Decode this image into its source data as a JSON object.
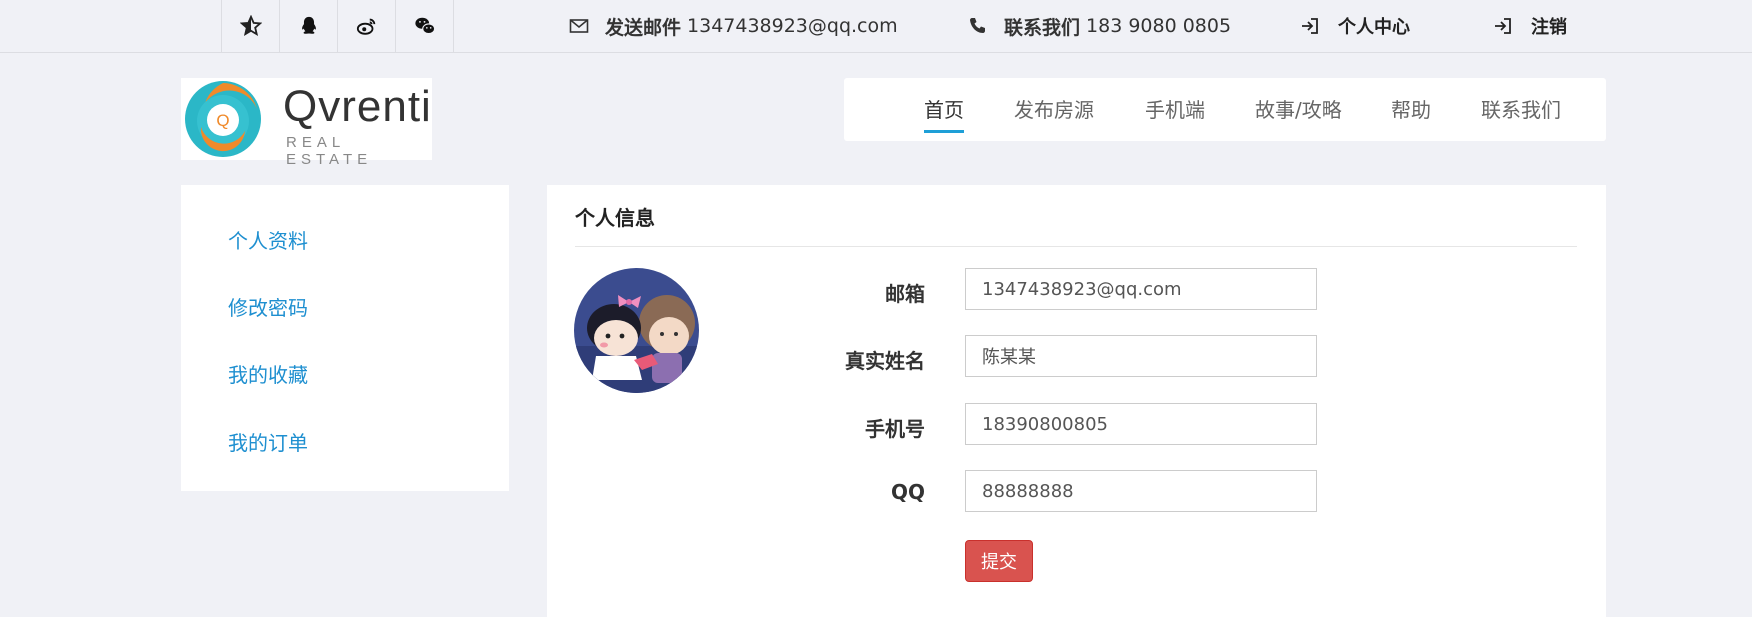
{
  "topbar": {
    "social_icons": [
      "star-icon",
      "qq-icon",
      "weibo-icon",
      "wechat-icon"
    ],
    "email": {
      "label": "发送邮件",
      "value": "1347438923@qq.com",
      "icon": "mail-icon"
    },
    "phone": {
      "label": "联系我们",
      "value": "183 9080 0805",
      "icon": "phone-icon"
    },
    "user_center": "个人中心",
    "logout": "注销"
  },
  "logo": {
    "brand": "Qvrenti",
    "tagline": "REAL ESTATE",
    "mark": "Q"
  },
  "nav": {
    "items": [
      "首页",
      "发布房源",
      "手机端",
      "故事/攻略",
      "帮助",
      "联系我们"
    ],
    "active": "首页"
  },
  "sidebar": {
    "items": [
      "个人资料",
      "修改密码",
      "我的收藏",
      "我的订单"
    ]
  },
  "profile": {
    "title": "个人信息",
    "fields": [
      {
        "label": "邮箱",
        "value": "1347438923@qq.com"
      },
      {
        "label": "真实姓名",
        "value": "陈某某"
      },
      {
        "label": "手机号",
        "value": "18390800805"
      },
      {
        "label": "QQ",
        "value": "88888888"
      }
    ],
    "submit_label": "提交"
  },
  "colors": {
    "accent": "#1e9fd7",
    "link": "#1e8fd0",
    "danger": "#d9534f",
    "background": "#f0f1f6"
  }
}
